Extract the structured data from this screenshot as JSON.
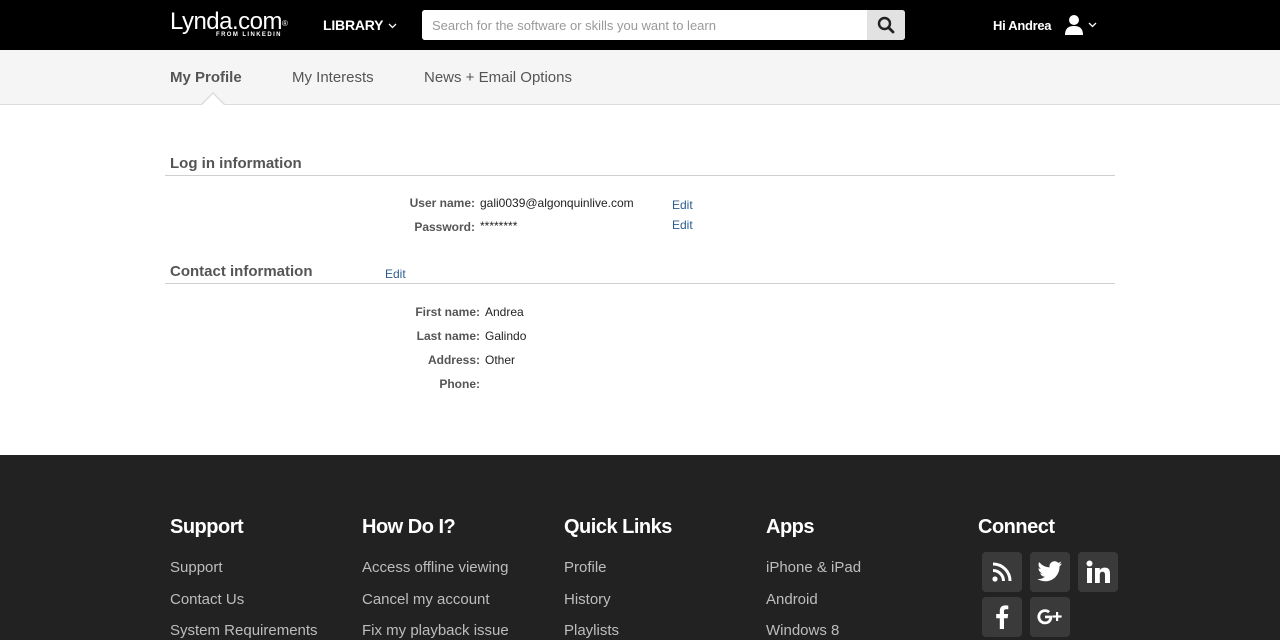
{
  "header": {
    "logo_main": "Lynda.com",
    "logo_reg": "®",
    "logo_sub": "FROM LINKEDIN",
    "library_label": "LIBRARY",
    "search_placeholder": "Search for the software or skills you want to learn",
    "greeting": "Hi Andrea",
    "icons": {
      "search": "search-icon",
      "user": "user-icon",
      "chevron": "chevron-down-icon"
    }
  },
  "subnav": {
    "tabs": [
      {
        "label": "My Profile",
        "active": true
      },
      {
        "label": "My Interests",
        "active": false
      },
      {
        "label": "News + Email Options",
        "active": false
      }
    ]
  },
  "login": {
    "title": "Log in information",
    "username_label": "User name:",
    "username_value": "gali0039@algonquinlive.com",
    "password_label": "Password:",
    "password_value": "********",
    "edit_label": "Edit"
  },
  "contact": {
    "title": "Contact information",
    "edit_label": "Edit",
    "fields": [
      {
        "label": "First name:",
        "value": "Andrea"
      },
      {
        "label": "Last name:",
        "value": "Galindo"
      },
      {
        "label": "Address:",
        "value": "Other"
      },
      {
        "label": "Phone:",
        "value": ""
      }
    ]
  },
  "footer": {
    "columns": [
      {
        "title": "Support",
        "links": [
          "Support",
          "Contact Us",
          "System Requirements"
        ]
      },
      {
        "title": "How Do I?",
        "links": [
          "Access offline viewing",
          "Cancel my account",
          "Fix my playback issue"
        ]
      },
      {
        "title": "Quick Links",
        "links": [
          "Profile",
          "History",
          "Playlists"
        ]
      },
      {
        "title": "Apps",
        "links": [
          "iPhone & iPad",
          "Android",
          "Windows 8"
        ]
      },
      {
        "title": "Connect",
        "links": []
      }
    ],
    "social_icons": [
      "rss-icon",
      "twitter-icon",
      "linkedin-icon",
      "facebook-icon",
      "google-plus-icon"
    ]
  },
  "colors": {
    "header_bg": "#000000",
    "subnav_bg": "#f5f5f5",
    "footer_bg": "#222222",
    "link": "#2a5d8f"
  }
}
